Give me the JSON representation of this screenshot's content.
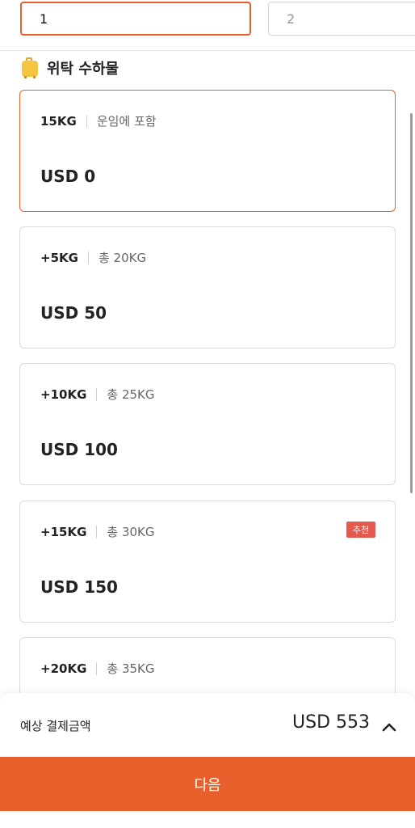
{
  "tabs": [
    {
      "label": "1",
      "active": true
    },
    {
      "label": "2",
      "active": false
    }
  ],
  "section": {
    "title": "위탁 수하물",
    "icon": "suitcase-icon"
  },
  "options": [
    {
      "weight": "15KG",
      "sub": "운임에 포함",
      "price": "USD 0",
      "selected": true
    },
    {
      "weight": "+5KG",
      "sub": "총 20KG",
      "price": "USD 50"
    },
    {
      "weight": "+10KG",
      "sub": "총 25KG",
      "price": "USD 100"
    },
    {
      "weight": "+15KG",
      "sub": "총 30KG",
      "price": "USD 150",
      "badge": "추천"
    },
    {
      "weight": "+20KG",
      "sub": "총 35KG",
      "price": ""
    }
  ],
  "footer": {
    "label": "예상 결제금액",
    "total": "USD 553",
    "toggle_icon": "chevron-up-icon"
  },
  "next_button": {
    "label": "다음"
  },
  "colors": {
    "accent": "#e8602c",
    "badge": "#e45a4d",
    "suitcase": "#f5c542"
  }
}
